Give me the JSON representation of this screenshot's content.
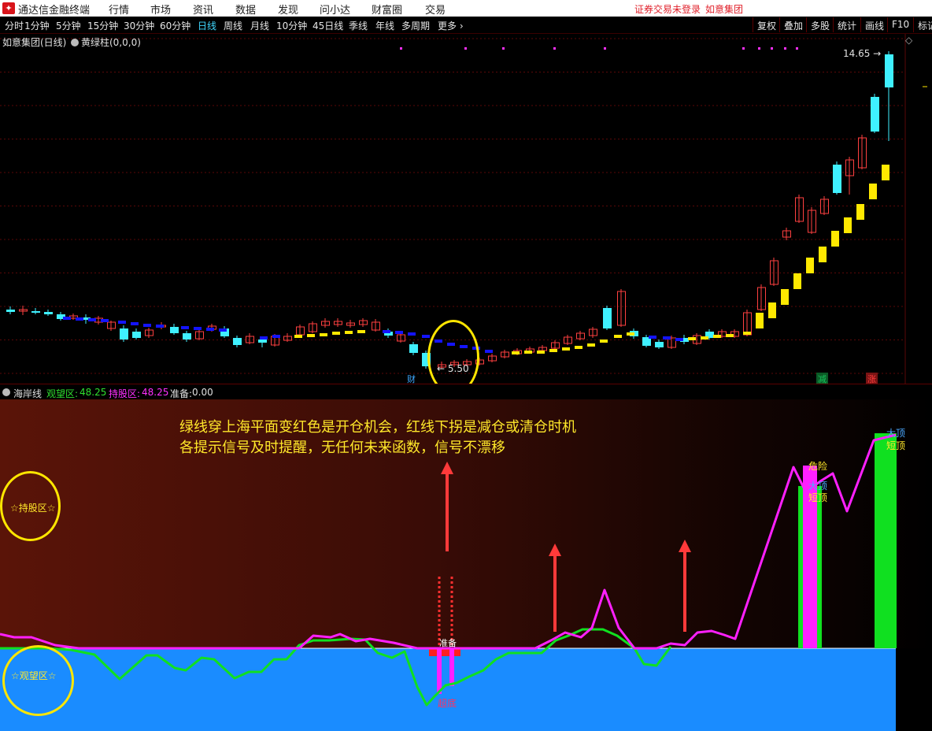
{
  "titlebar": {
    "app_name": "通达信金融终端",
    "menus": [
      "行情",
      "市场",
      "资讯",
      "数据",
      "发现",
      "问小达",
      "财富圈",
      "交易"
    ],
    "warning": "证券交易未登录",
    "stock_link": "如意集团"
  },
  "periods": [
    "分时",
    "1分钟",
    "5分钟",
    "15分钟",
    "30分钟",
    "60分钟",
    "日线",
    "周线",
    "月线",
    "10分钟",
    "45日线",
    "季线",
    "年线",
    "多周期",
    "更多 ›"
  ],
  "active_period": "日线",
  "right_buttons": [
    "复权",
    "叠加",
    "多股",
    "统计",
    "画线",
    "F10",
    "标记"
  ],
  "main_chart": {
    "stock_title": "如意集团(日线)",
    "indicator_title": "黄绿柱(0,0,0)",
    "high_label": "14.65",
    "low_label": "5.50",
    "events": [
      {
        "label": "财",
        "color": "#3fa8ff"
      },
      {
        "label": "减",
        "color": "#18c05a"
      },
      {
        "label": "涨",
        "color": "#ff3b3b"
      }
    ]
  },
  "sub_chart": {
    "name": "海岸线",
    "watch_label": "观望区:",
    "watch_value": "48.25",
    "hold_label": "持股区:",
    "hold_value": "48.25",
    "prep_label": "准备:",
    "prep_value": "0.00",
    "note_line1": "绿线穿上海平面变红色是开仓机会，红线下拐是减仓或清仓时机",
    "note_line2": "各提示信号及时提醒，无任何未来函数，信号不漂移",
    "hold_zone": "☆持股区☆",
    "watch_zone": "☆观望区☆",
    "labels": {
      "bottom": "超底",
      "prep": "准备",
      "danger": "危险",
      "bigtop": "大顶",
      "shorttop": "短顶",
      "bigtop2": "大顶",
      "shorttop2": "短顶"
    }
  },
  "colors": {
    "up": "#ff4040",
    "down": "#3ff0ff",
    "support_blue": "#1414ff",
    "support_yellow": "#ffe800",
    "sea": "#1a8cff",
    "magenta": "#ff20ff",
    "green": "#10e020"
  }
}
